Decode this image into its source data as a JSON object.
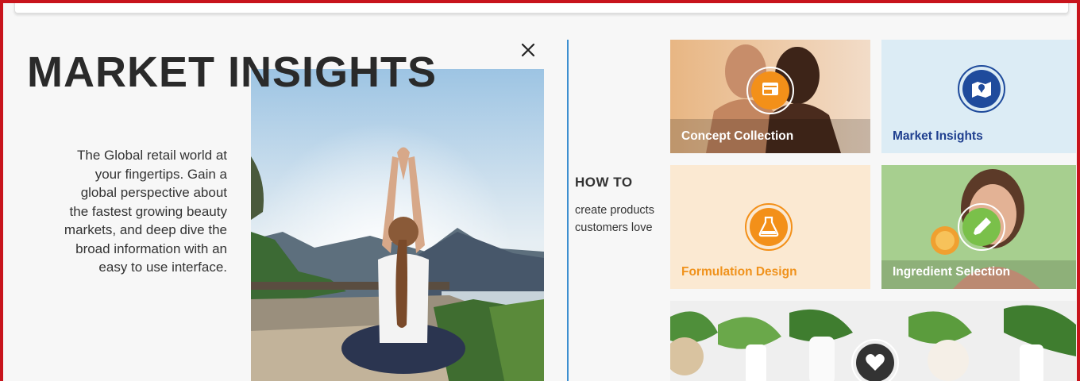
{
  "page": {
    "title": "MARKET INSIGHTS",
    "description": "The Global retail world at your fingertips. Gain a global perspective about the fastest growing beauty markets, and deep dive the broad information with an easy to use interface."
  },
  "howto": {
    "title": "HOW TO",
    "text": "create products customers love"
  },
  "cards": [
    {
      "label": "Concept Collection",
      "icon": "folder-icon",
      "label_color": "#ffffff"
    },
    {
      "label": "Market Insights",
      "icon": "map-pin-icon",
      "label_color": "#1f3f8f"
    },
    {
      "label": "Formulation Design",
      "icon": "flask-icon",
      "label_color": "#f0921c"
    },
    {
      "label": "Ingredient Selection",
      "icon": "dropper-icon",
      "label_color": "#ffffff"
    },
    {
      "label": "",
      "icon": "heart-icon"
    }
  ],
  "colors": {
    "frame_border": "#c8141c",
    "accent_orange": "#f39019",
    "accent_blue": "#1f4b9c",
    "accent_green": "#7ac04a",
    "divider_blue": "#3d8fd0"
  }
}
